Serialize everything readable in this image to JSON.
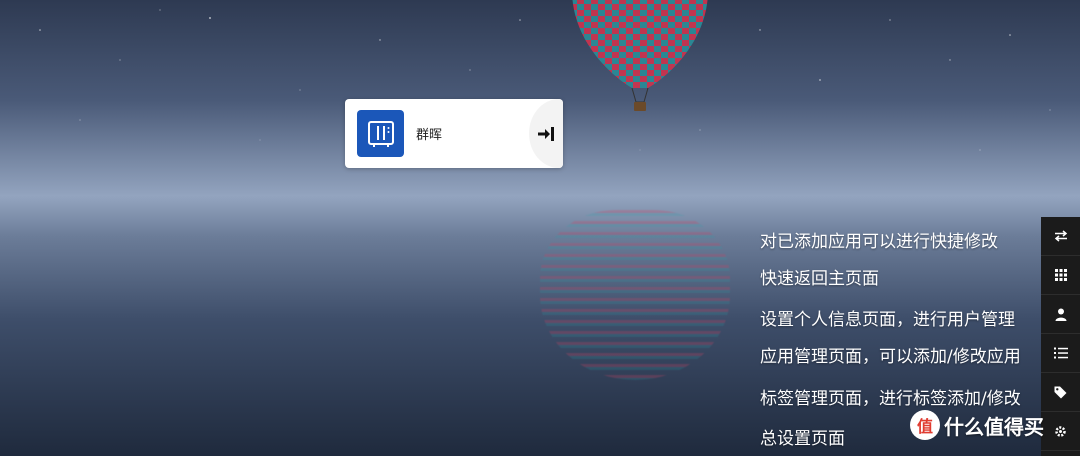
{
  "app_card": {
    "name": "群晖"
  },
  "tips": [
    "对已添加应用可以进行快捷修改",
    "快速返回主页面",
    "设置个人信息页面，进行用户管理",
    "应用管理页面，可以添加/修改应用",
    "标签管理页面，进行标签添加/修改",
    "总设置页面"
  ],
  "toolbar": {
    "items": [
      {
        "icon": "swap-arrows-icon"
      },
      {
        "icon": "grid-icon"
      },
      {
        "icon": "user-icon"
      },
      {
        "icon": "list-icon"
      },
      {
        "icon": "tag-icon"
      },
      {
        "icon": "gear-icon"
      }
    ]
  },
  "watermark": {
    "logo_text": "值",
    "text": "什么值得买"
  },
  "colors": {
    "app_icon_bg": "#1b57b9",
    "toolbar_bg": "#1b1b1b"
  }
}
